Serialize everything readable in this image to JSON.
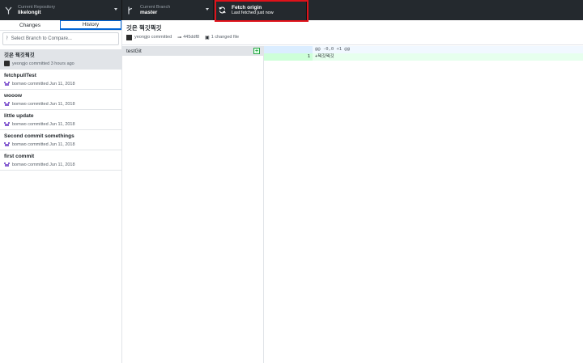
{
  "toolbar": {
    "repo": {
      "label": "Current Repository",
      "value": "likelongit"
    },
    "branch": {
      "label": "Current Branch",
      "value": "master"
    },
    "fetch": {
      "title": "Fetch origin",
      "subtitle": "Last fetched just now"
    }
  },
  "sidebar": {
    "tabs": [
      "Changes",
      "History"
    ],
    "active_tab": "History",
    "compare_placeholder": "Select Branch to Compare...",
    "commits": [
      {
        "title": "깃은 꿕깃꿕깃",
        "author": "yeongjo committed 3 hours ago",
        "selected": true
      },
      {
        "title": "fetchpullTest",
        "author": "bomwo committed Jun 11, 2018"
      },
      {
        "title": "wooow",
        "author": "bomwo committed Jun 11, 2018"
      },
      {
        "title": "little update",
        "author": "bomwo committed Jun 11, 2018"
      },
      {
        "title": "Second commit somethings",
        "author": "bomwo committed Jun 11, 2018"
      },
      {
        "title": "first commit",
        "author": "bomwo committed Jun 11, 2018"
      }
    ]
  },
  "commit_detail": {
    "title": "깃은 꿕깃꿕깃",
    "author": "yeongjo committed",
    "sha": "445ddf8",
    "changed": "1 changed file",
    "files": [
      {
        "name": "testGit",
        "status": "added"
      }
    ],
    "diff": {
      "hunk": "@@ -0,0 +1 @@",
      "lines": [
        {
          "new_ln": "1",
          "text": "+꿕깃꿕깃"
        }
      ]
    }
  },
  "colors": {
    "toolbar": "#24292e",
    "accent": "#0366d6",
    "highlight": "#e0121a",
    "added": "#28a745"
  }
}
